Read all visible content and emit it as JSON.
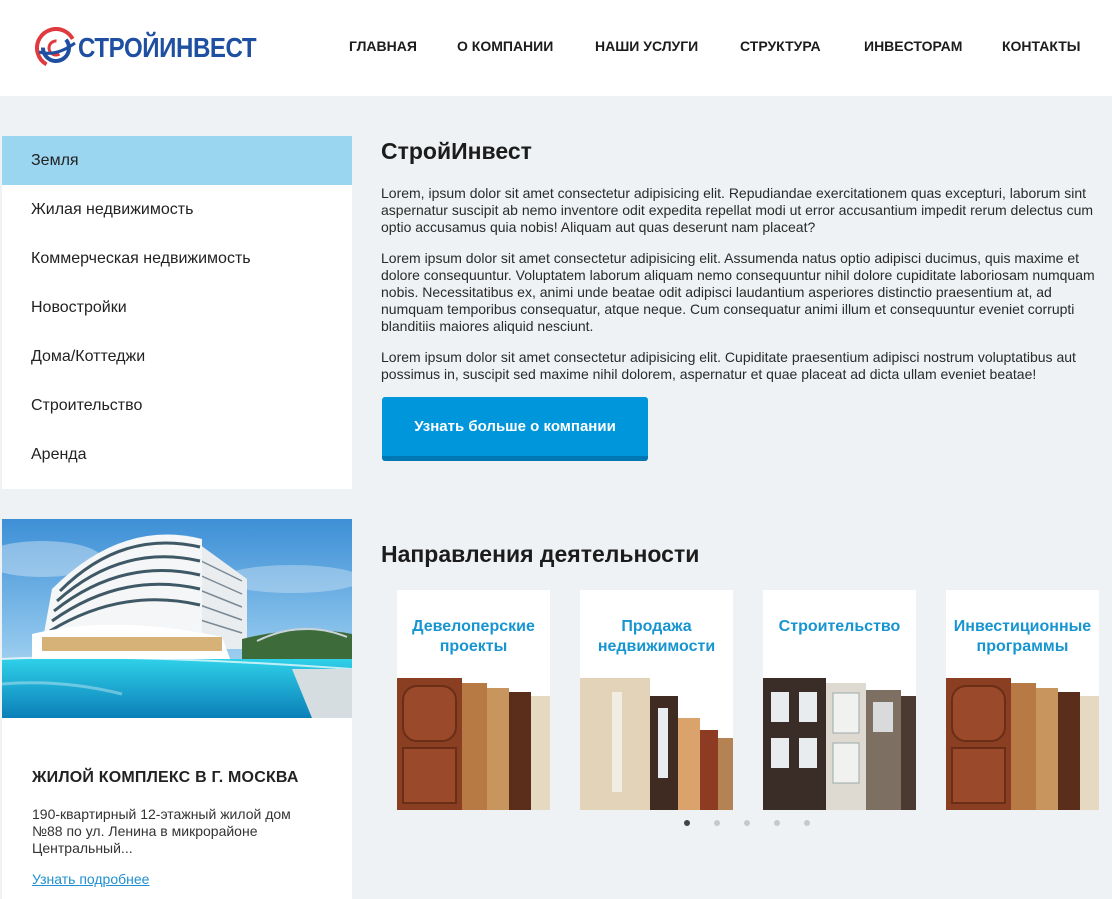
{
  "brand": {
    "name": "СТРОЙИНВЕСТ",
    "primary_color": "#1f4fa0",
    "accent_color": "#e03a3e"
  },
  "nav": {
    "items": [
      "ГЛАВНАЯ",
      "О КОМПАНИИ",
      "НАШИ УСЛУГИ",
      "СТРУКТУРА",
      "ИНВЕСТОРАМ",
      "КОНТАКТЫ"
    ]
  },
  "sidebar": {
    "items": [
      {
        "label": "Земля",
        "active": true
      },
      {
        "label": "Жилая недвижимость",
        "active": false
      },
      {
        "label": "Коммерческая недвижимость",
        "active": false
      },
      {
        "label": "Новостройки",
        "active": false
      },
      {
        "label": "Дома/Коттеджи",
        "active": false
      },
      {
        "label": "Строительство",
        "active": false
      },
      {
        "label": "Аренда",
        "active": false
      }
    ],
    "active_color": "#9bd6f1"
  },
  "promo": {
    "title": "ЖИЛОЙ КОМПЛЕКС В Г. МОСКВА",
    "text": "190-квартирный 12-этажный жилой дом №88 по ул. Ленина в микрорайоне Центральный...",
    "link": "Узнать подробнее"
  },
  "about": {
    "title": "СтройИнвест",
    "paragraphs": [
      "Lorem, ipsum dolor sit amet consectetur adipisicing elit. Repudiandae exercitationem quas excepturi, laborum sint aspernatur suscipit ab nemo inventore odit expedita repellat modi ut error accusantium impedit rerum delectus cum optio accusamus quia nobis! Aliquam aut quas deserunt nam placeat?",
      "Lorem ipsum dolor sit amet consectetur adipisicing elit. Assumenda natus optio adipisci ducimus, quis maxime et dolore consequuntur. Voluptatem laborum aliquam nemo consequuntur nihil dolore cupiditate laboriosam numquam nobis. Necessitatibus ex, animi unde beatae odit adipisci laudantium asperiores distinctio praesentium at, ad numquam temporibus consequatur, atque neque. Cum consequatur animi illum et consequuntur eveniet corrupti blanditiis maiores aliquid nesciunt.",
      "Lorem ipsum dolor sit amet consectetur adipisicing elit. Cupiditate praesentium adipisci nostrum voluptatibus aut possimus in, suscipit sed maxime nihil dolorem, aspernatur et quae placeat ad dicta ullam eveniet beatae!"
    ],
    "cta": "Узнать больше о компании",
    "cta_color": "#0096db"
  },
  "directions": {
    "title": "Направления деятельности",
    "cards": [
      {
        "title": "Девелоперские проекты"
      },
      {
        "title": "Продажа недвижимости"
      },
      {
        "title": "Строительство"
      },
      {
        "title": "Инвестиционные программы"
      }
    ],
    "slider": {
      "total": 5,
      "active": 1
    }
  }
}
